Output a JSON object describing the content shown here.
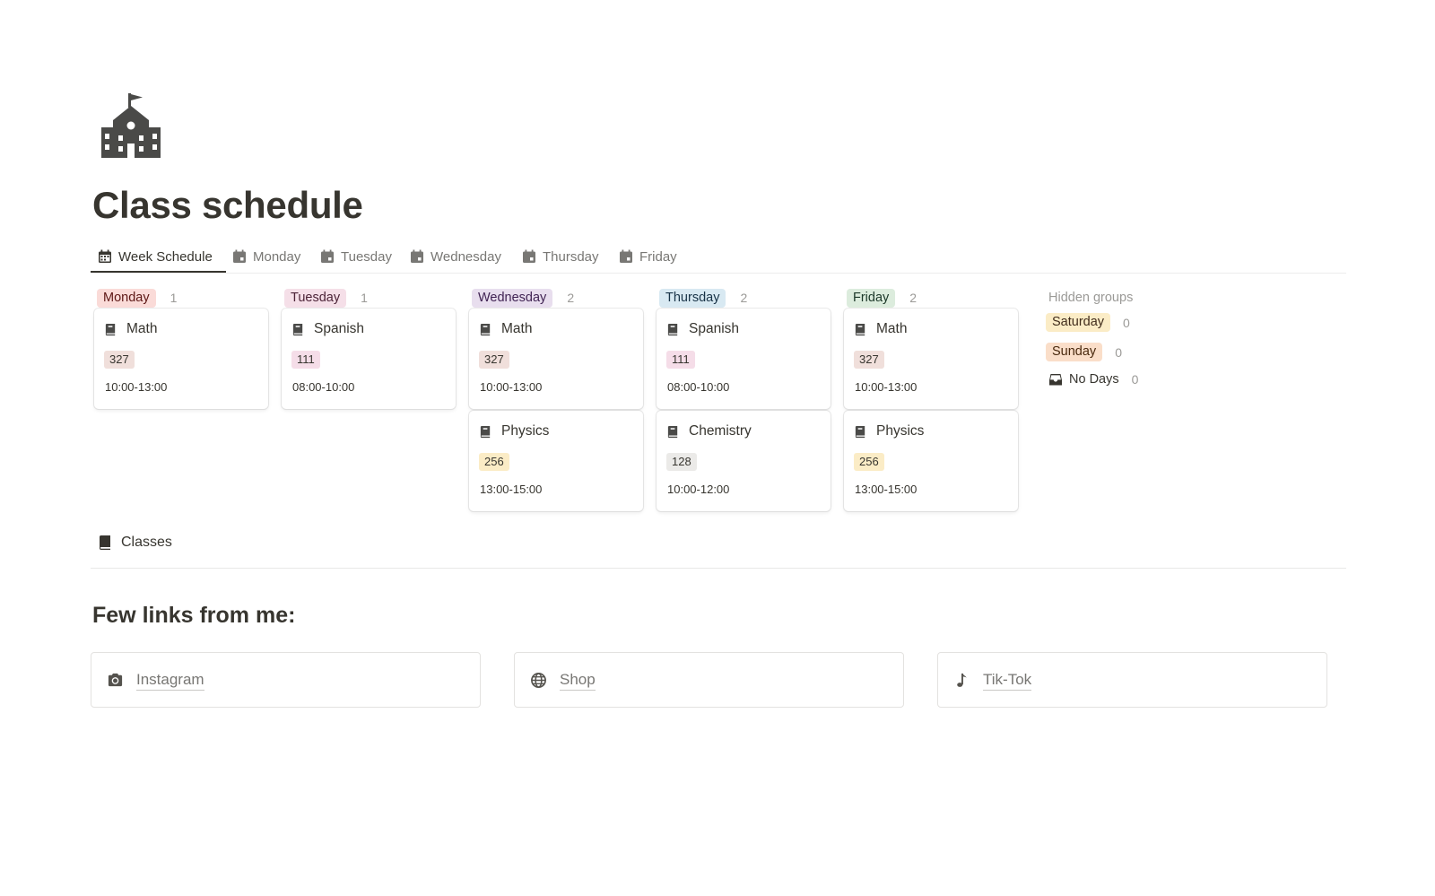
{
  "page": {
    "title": "Class schedule",
    "icon": "school-icon"
  },
  "tabs": [
    {
      "label": "Week Schedule",
      "icon": "calendar-icon",
      "active": true
    },
    {
      "label": "Monday",
      "icon": "calendar-icon"
    },
    {
      "label": "Tuesday",
      "icon": "calendar-icon"
    },
    {
      "label": "Wednesday",
      "icon": "calendar-icon"
    },
    {
      "label": "Thursday",
      "icon": "calendar-icon"
    },
    {
      "label": "Friday",
      "icon": "calendar-icon"
    }
  ],
  "board": {
    "columns": [
      {
        "label": "Monday",
        "count": "1",
        "bg": "#fadbd8",
        "fg": "#5d1715",
        "cards": [
          {
            "title": "Math",
            "room": "327",
            "room_bg": "#f0dfdb",
            "time": "10:00-13:00"
          }
        ]
      },
      {
        "label": "Tuesday",
        "count": "1",
        "bg": "#f5dfe8",
        "fg": "#4c2337",
        "cards": [
          {
            "title": "Spanish",
            "room": "111",
            "room_bg": "#f5dde8",
            "time": "08:00-10:00"
          }
        ]
      },
      {
        "label": "Wednesday",
        "count": "2",
        "bg": "#e8deee",
        "fg": "#412454",
        "cards": [
          {
            "title": "Math",
            "room": "327",
            "room_bg": "#f0dfdb",
            "time": "10:00-13:00"
          },
          {
            "title": "Physics",
            "room": "256",
            "room_bg": "#fbecc6",
            "time": "13:00-15:00"
          }
        ]
      },
      {
        "label": "Thursday",
        "count": "2",
        "bg": "#d8e9f2",
        "fg": "#183347",
        "cards": [
          {
            "title": "Spanish",
            "room": "111",
            "room_bg": "#f5dde8",
            "time": "08:00-10:00"
          },
          {
            "title": "Chemistry",
            "room": "128",
            "room_bg": "#ebeae8",
            "time": "10:00-12:00"
          }
        ]
      },
      {
        "label": "Friday",
        "count": "2",
        "bg": "#dcecdd",
        "fg": "#1c3829",
        "cards": [
          {
            "title": "Math",
            "room": "327",
            "room_bg": "#f0dfdb",
            "time": "10:00-13:00"
          },
          {
            "title": "Physics",
            "room": "256",
            "room_bg": "#fbecc6",
            "time": "13:00-15:00"
          }
        ]
      }
    ],
    "card_icon": "book-icon"
  },
  "hidden_groups": {
    "title": "Hidden groups",
    "items": [
      {
        "label": "Saturday",
        "count": "0",
        "bg": "#fbecc6",
        "fg": "#402c1b"
      },
      {
        "label": "Sunday",
        "count": "0",
        "bg": "#fadec9",
        "fg": "#49290e"
      }
    ],
    "no_days": {
      "label": "No Days",
      "count": "0",
      "icon": "inbox-icon"
    }
  },
  "classes_link": {
    "label": "Classes",
    "icon": "book-icon"
  },
  "links_section": {
    "heading": "Few links from me:",
    "links": [
      {
        "label": "Instagram",
        "icon": "camera-icon"
      },
      {
        "label": "Shop",
        "icon": "globe-icon"
      },
      {
        "label": "Tik-Tok",
        "icon": "music-note-icon"
      }
    ]
  }
}
